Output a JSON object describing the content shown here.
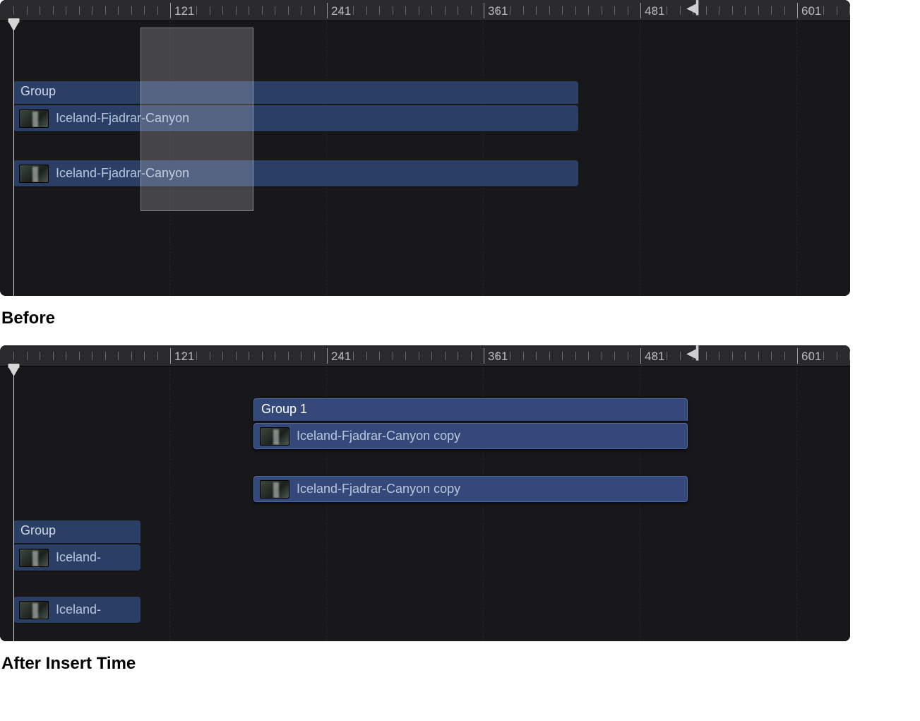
{
  "ruler": {
    "ticks": [
      121,
      241,
      361,
      481,
      601
    ]
  },
  "captions": {
    "before": "Before",
    "after": "After Insert Time"
  },
  "before": {
    "group_label": "Group",
    "clip1_label": "Iceland-Fjadrar-Canyon",
    "clip2_label": "Iceland-Fjadrar-Canyon"
  },
  "after": {
    "group1_label": "Group 1",
    "clip1_label": "Iceland-Fjadrar-Canyon copy",
    "clip2_label": "Iceland-Fjadrar-Canyon copy",
    "group_orig_label": "Group",
    "clip_orig1_label": "Iceland-",
    "clip_orig2_label": "Iceland-"
  }
}
